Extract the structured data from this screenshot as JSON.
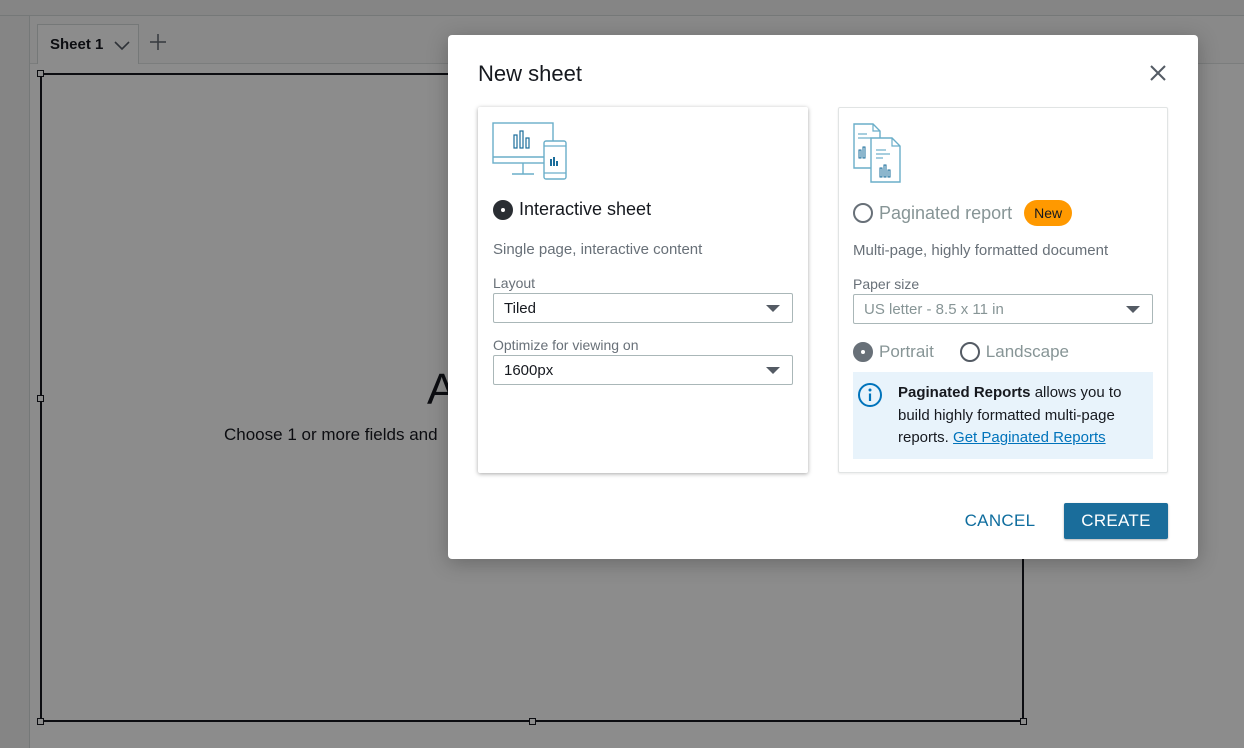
{
  "background": {
    "sheet_tab": {
      "label": "Sheet 1"
    },
    "canvas": {
      "big_text": "A",
      "hint": "Choose 1 or more fields and"
    }
  },
  "modal": {
    "title": "New sheet",
    "interactive": {
      "label": "Interactive sheet",
      "description": "Single page, interactive content",
      "layout_label": "Layout",
      "layout_value": "Tiled",
      "optimize_label": "Optimize for viewing on",
      "optimize_value": "1600px",
      "selected": true
    },
    "paginated": {
      "label": "Paginated report",
      "badge": "New",
      "description": "Multi-page, highly formatted document",
      "paper_label": "Paper size",
      "paper_value": "US letter - 8.5 x 11 in",
      "portrait_label": "Portrait",
      "landscape_label": "Landscape",
      "info_strong": "Paginated Reports",
      "info_text": " allows you to build highly formatted multi-page reports. ",
      "info_link": "Get Paginated Reports",
      "selected": false
    },
    "cancel_label": "CANCEL",
    "create_label": "CREATE"
  },
  "colors": {
    "primary_button": "#1a6d9b",
    "badge": "#ff9900",
    "info_background": "#e8f3fb",
    "link": "#0073bb",
    "illustration": "#6aaec9"
  },
  "icons": [
    "chevron-down-icon",
    "plus-icon",
    "close-icon",
    "info-icon",
    "dashboard-illustration-icon",
    "report-illustration-icon"
  ]
}
